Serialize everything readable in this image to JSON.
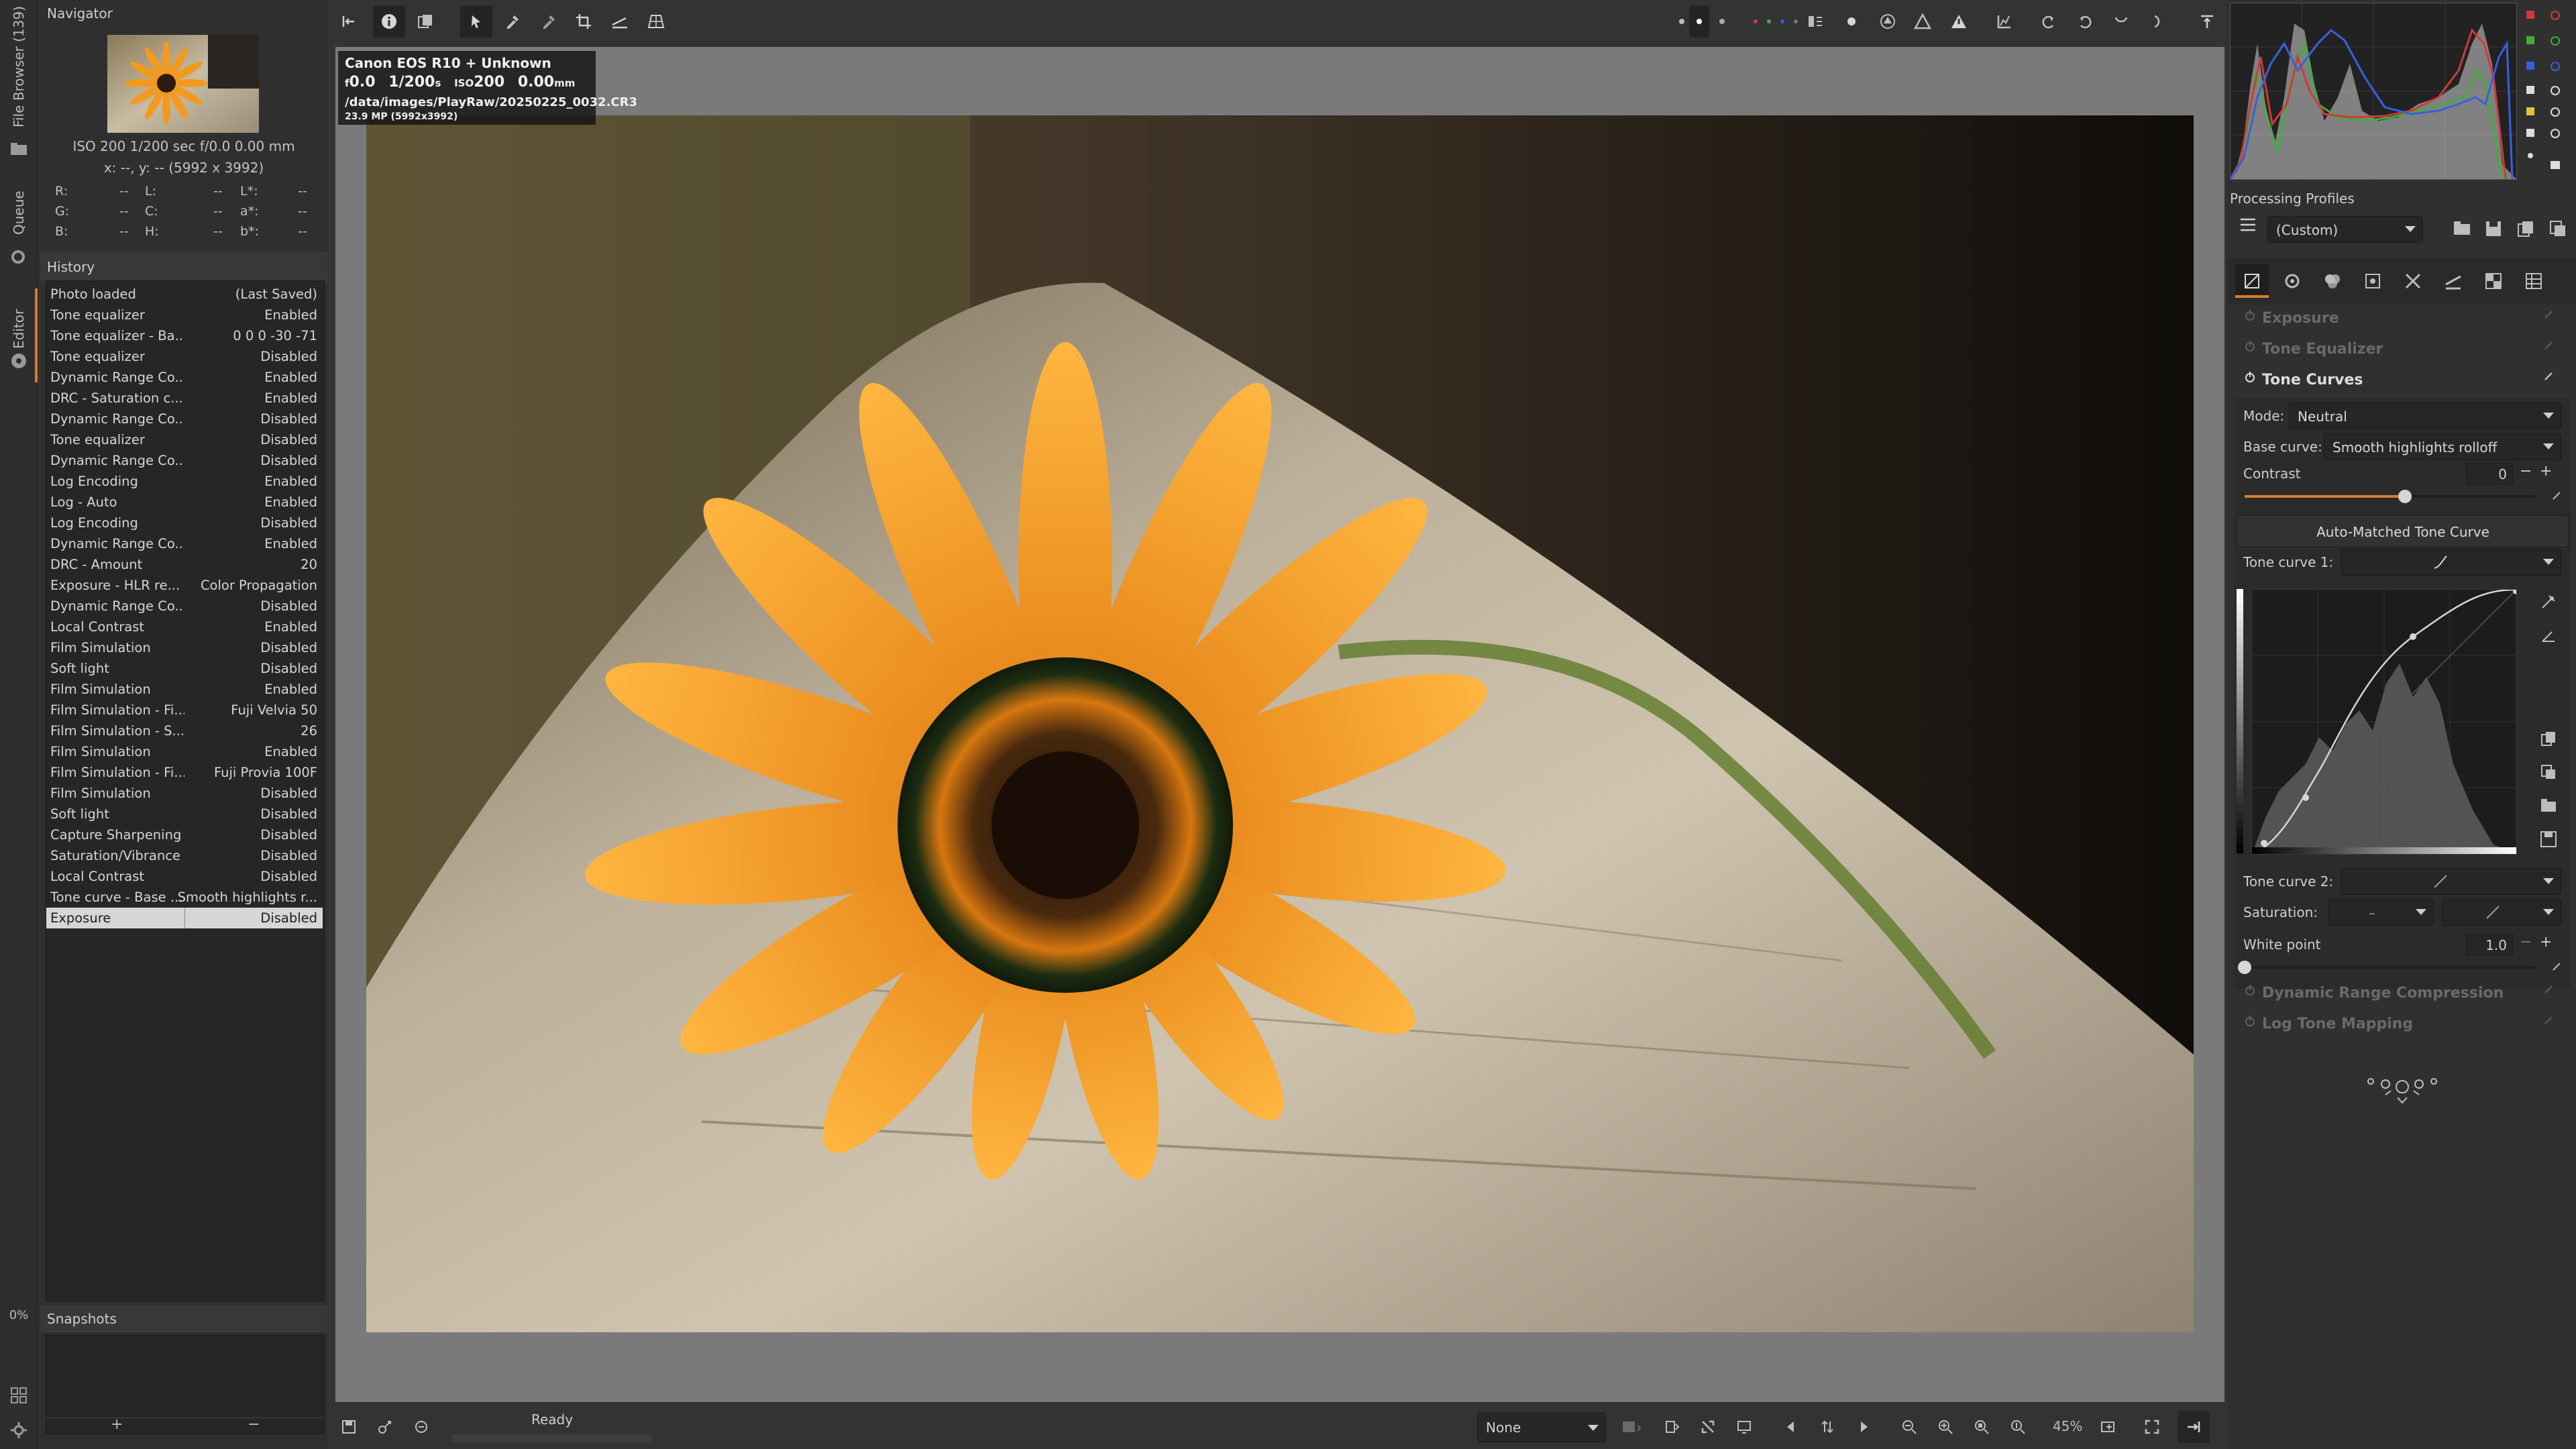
{
  "left_tabs": {
    "file_browser": "File Browser (139)",
    "queue": "Queue",
    "editor": "Editor",
    "progress": "0%"
  },
  "navigator": {
    "title": "Navigator",
    "exif_line": "ISO 200    1/200 sec    f/0.0    0.00 mm",
    "coords": "x: --, y: --    (5992 x 3992)",
    "rows": [
      {
        "a": "R:",
        "av": "--",
        "b": "L:",
        "bv": "--",
        "c": "L*:",
        "cv": "--"
      },
      {
        "a": "G:",
        "av": "--",
        "b": "C:",
        "bv": "--",
        "c": "a*:",
        "cv": "--"
      },
      {
        "a": "B:",
        "av": "--",
        "b": "H:",
        "bv": "--",
        "c": "b*:",
        "cv": "--"
      }
    ]
  },
  "history": {
    "title": "History",
    "items": [
      {
        "label": "Photo loaded",
        "value": "(Last Saved)"
      },
      {
        "label": "Tone equalizer",
        "value": "Enabled"
      },
      {
        "label": "Tone equalizer - Ba...",
        "value": "0 0 0 -30 -71"
      },
      {
        "label": "Tone equalizer",
        "value": "Disabled"
      },
      {
        "label": "Dynamic Range Co...",
        "value": "Enabled"
      },
      {
        "label": "DRC - Saturation c...",
        "value": "Enabled"
      },
      {
        "label": "Dynamic Range Co...",
        "value": "Disabled"
      },
      {
        "label": "Tone equalizer",
        "value": "Disabled"
      },
      {
        "label": "Dynamic Range Co...",
        "value": "Disabled"
      },
      {
        "label": "Log Encoding",
        "value": "Enabled"
      },
      {
        "label": "Log - Auto",
        "value": "Enabled"
      },
      {
        "label": "Log Encoding",
        "value": "Disabled"
      },
      {
        "label": "Dynamic Range Co...",
        "value": "Enabled"
      },
      {
        "label": "DRC - Amount",
        "value": "20"
      },
      {
        "label": "Exposure - HLR re...",
        "value": "Color Propagation"
      },
      {
        "label": "Dynamic Range Co...",
        "value": "Disabled"
      },
      {
        "label": "Local Contrast",
        "value": "Enabled"
      },
      {
        "label": "Film Simulation",
        "value": "Disabled"
      },
      {
        "label": "Soft light",
        "value": "Disabled"
      },
      {
        "label": "Film Simulation",
        "value": "Enabled"
      },
      {
        "label": "Film Simulation - Fi...",
        "value": "Fuji Velvia 50"
      },
      {
        "label": "Film Simulation - S...",
        "value": "26"
      },
      {
        "label": "Film Simulation",
        "value": "Enabled"
      },
      {
        "label": "Film Simulation - Fi...",
        "value": "Fuji Provia 100F"
      },
      {
        "label": "Film Simulation",
        "value": "Disabled"
      },
      {
        "label": "Soft light",
        "value": "Disabled"
      },
      {
        "label": "Capture Sharpening",
        "value": "Disabled"
      },
      {
        "label": "Saturation/Vibrance",
        "value": "Disabled"
      },
      {
        "label": "Local Contrast",
        "value": "Disabled"
      },
      {
        "label": "Tone curve - Base ...",
        "value": "Smooth highlights r..."
      },
      {
        "label": "Exposure",
        "value": "Disabled"
      }
    ],
    "selected_index": 30
  },
  "snapshots": {
    "title": "Snapshots",
    "add": "+",
    "remove": "−"
  },
  "image_info": {
    "camera": "Canon EOS R10 + Unknown",
    "f_prefix": "f",
    "f_value": "0.0",
    "shutter": "1/200",
    "shutter_unit": "s",
    "iso_prefix": "ISO",
    "iso_value": "200",
    "focal": "0.00",
    "focal_unit": "mm",
    "path": "/data/images/PlayRaw/20250225_0032.CR3",
    "size": "23.9 MP (5992x3992)"
  },
  "bottom": {
    "status": "Ready",
    "preview_mode": "None",
    "zoom": "45%"
  },
  "processing_profiles": {
    "title": "Processing Profiles",
    "current": "(Custom)"
  },
  "tools": {
    "exposure": "Exposure",
    "tone_equalizer": "Tone Equalizer",
    "tone_curves": "Tone Curves",
    "mode_label": "Mode:",
    "mode_value": "Neutral",
    "base_curve_label": "Base curve:",
    "base_curve_value": "Smooth highlights rolloff",
    "contrast_label": "Contrast",
    "contrast_value": "0",
    "contrast_level": 0.55,
    "auto_matched": "Auto-Matched Tone Curve",
    "tone_curve_1": "Tone curve 1:",
    "tone_curve_2": "Tone curve 2:",
    "saturation_label": "Saturation:",
    "saturation_value": "–",
    "white_point_label": "White point",
    "white_point_value": "1.0",
    "white_point_level": 0.0,
    "drc": "Dynamic Range Compression",
    "log_tone": "Log Tone Mapping"
  },
  "colors": {
    "selected_row": "#d6d6d6",
    "accent_tab": "#d97d2b",
    "histogram_red": "#d23a3a",
    "histogram_green": "#3fae3f",
    "histogram_blue": "#3a5fe0"
  }
}
